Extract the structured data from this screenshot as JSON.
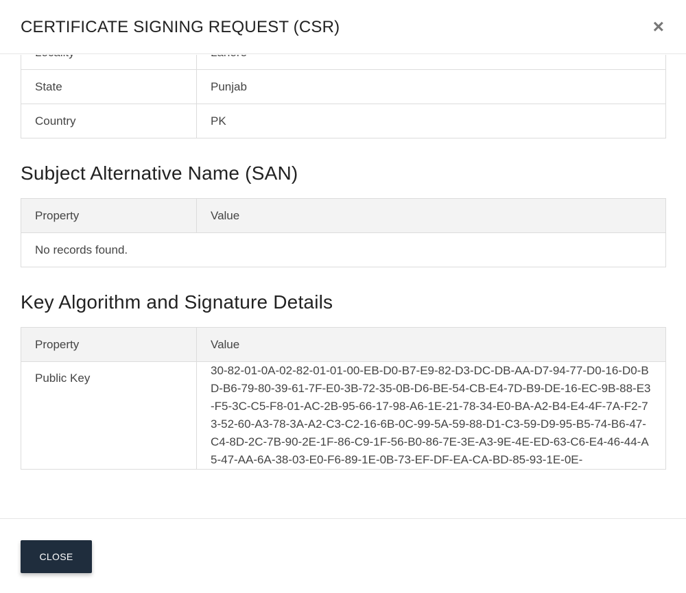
{
  "dialog": {
    "title": "CERTIFICATE SIGNING REQUEST (CSR)",
    "close_icon": "×"
  },
  "subject_table": {
    "rows": [
      {
        "property": "Locality",
        "value": "Lahore"
      },
      {
        "property": "State",
        "value": "Punjab"
      },
      {
        "property": "Country",
        "value": "PK"
      }
    ]
  },
  "san_section": {
    "heading": "Subject Alternative Name (SAN)",
    "headers": {
      "property": "Property",
      "value": "Value"
    },
    "empty_message": "No records found."
  },
  "key_section": {
    "heading": "Key Algorithm and Signature Details",
    "headers": {
      "property": "Property",
      "value": "Value"
    },
    "rows": [
      {
        "property": "Public Key",
        "value": "30-82-01-0A-02-82-01-01-00-EB-D0-B7-E9-82-D3-DC-DB-AA-D7-94-77-D0-16-D0-BD-B6-79-80-39-61-7F-E0-3B-72-35-0B-D6-BE-54-CB-E4-7D-B9-DE-16-EC-9B-88-E3-F5-3C-C5-F8-01-AC-2B-95-66-17-98-A6-1E-21-78-34-E0-BA-A2-B4-E4-4F-7A-F2-73-52-60-A3-78-3A-A2-C3-C2-16-6B-0C-99-5A-59-88-D1-C3-59-D9-95-B5-74-B6-47-C4-8D-2C-7B-90-2E-1F-86-C9-1F-56-B0-86-7E-3E-A3-9E-4E-ED-63-C6-E4-46-44-A5-47-AA-6A-38-03-E0-F6-89-1E-0B-73-EF-DF-EA-CA-BD-85-93-1E-0E-"
      }
    ]
  },
  "footer": {
    "close_label": "CLOSE"
  }
}
